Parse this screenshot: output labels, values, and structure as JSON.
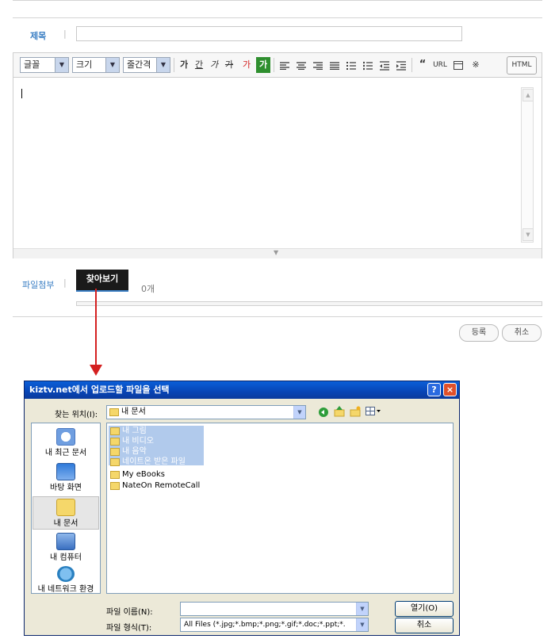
{
  "form": {
    "title_label": "제목",
    "title_value": "",
    "attach_label": "파일첨부",
    "browse_label": "찾아보기",
    "file_count": "0개",
    "submit_label": "등록",
    "cancel_label": "취소"
  },
  "editor": {
    "font_select": "글꼴",
    "size_select": "크기",
    "spacing_select": "줄간격",
    "format_buttons": [
      "가",
      "간",
      "가",
      "가",
      "가",
      "가"
    ],
    "extra_buttons": [
      "“",
      "URL"
    ],
    "html_label": "HTML",
    "content": ""
  },
  "dialog": {
    "title": "kiztv.net에서 업로드할 파일을 선택",
    "help_button": "?",
    "close_button": "×",
    "look_in_label": "찾는 위치(I):",
    "look_in_value": "내 문서",
    "places": [
      "내 최근 문서",
      "바탕 화면",
      "내 문서",
      "내 컴퓨터",
      "내 네트워크 환경"
    ],
    "files": [
      {
        "name": "내 그림",
        "selected": true
      },
      {
        "name": "내 비디오",
        "selected": true
      },
      {
        "name": "내 음악",
        "selected": true
      },
      {
        "name": "네이트온 받은 파일",
        "selected": true
      },
      {
        "name": "My eBooks",
        "selected": false
      },
      {
        "name": "NateOn RemoteCall",
        "selected": false
      }
    ],
    "filename_label": "파일 이름(N):",
    "filename_value": "",
    "filetype_label": "파일 형식(T):",
    "filetype_value": "All Files (*.jpg;*.bmp;*.png;*.gif;*.doc;*.ppt;*.",
    "open_label": "열기(O)",
    "cancel_label": "취소"
  },
  "colors": {
    "accent_blue": "#3b7fc4",
    "arrow_red": "#d42020",
    "xp_title": "#0a4fc9"
  }
}
